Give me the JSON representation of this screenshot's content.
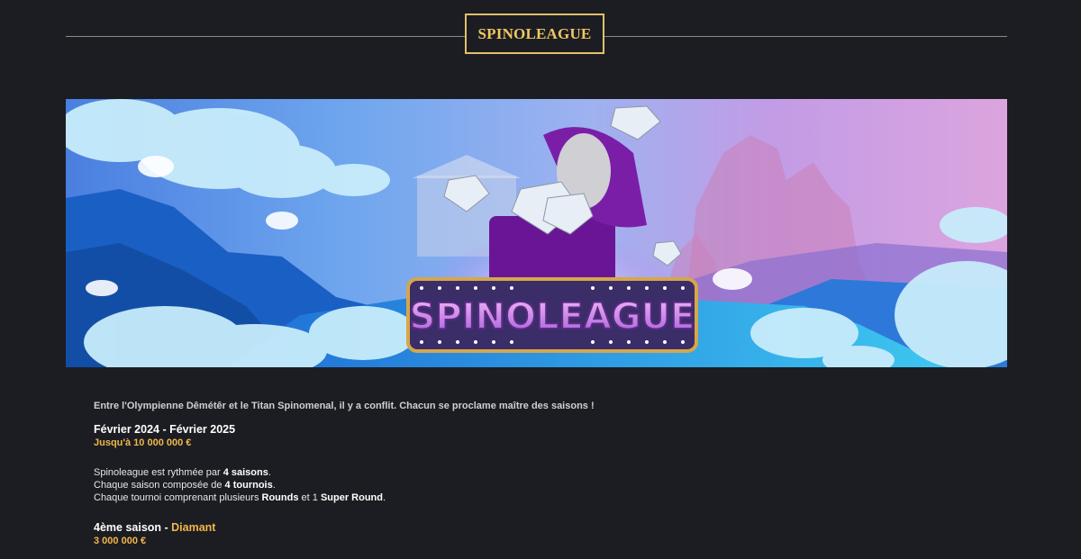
{
  "header": {
    "logo_text": "SPINOLEAGUE"
  },
  "banner": {
    "logo_text": "SPINOLEAGUE",
    "colors": {
      "sky_left": "#4a7fe0",
      "sky_right": "#dca4de",
      "gem_box": "#7a1ea8",
      "logo_fill": "#d98ae8",
      "logo_outline": "#d7a64a"
    }
  },
  "content": {
    "intro": "Entre l'Olympienne Dêmétêr et le Titan Spinomenal, il y a conflit. Chacun se proclame maître des saisons !",
    "dates": "Février 2024 - Février 2025",
    "prize": "Jusqu'à 10 000 000 €",
    "line1_pre": "Spinoleague est rythmée par ",
    "line1_bold": "4 saisons",
    "line1_post": ".",
    "line2_pre": "Chaque saison composée de ",
    "line2_bold": "4 tournois",
    "line2_post": ".",
    "line3_pre": "Chaque tournoi comprenant plusieurs ",
    "line3_bold1": "Rounds",
    "line3_mid": " et 1 ",
    "line3_bold2": "Super Round",
    "line3_post": ".",
    "season_label": "4ème saison - ",
    "season_name": "Diamant",
    "season_prize": "3 000 000 €"
  }
}
